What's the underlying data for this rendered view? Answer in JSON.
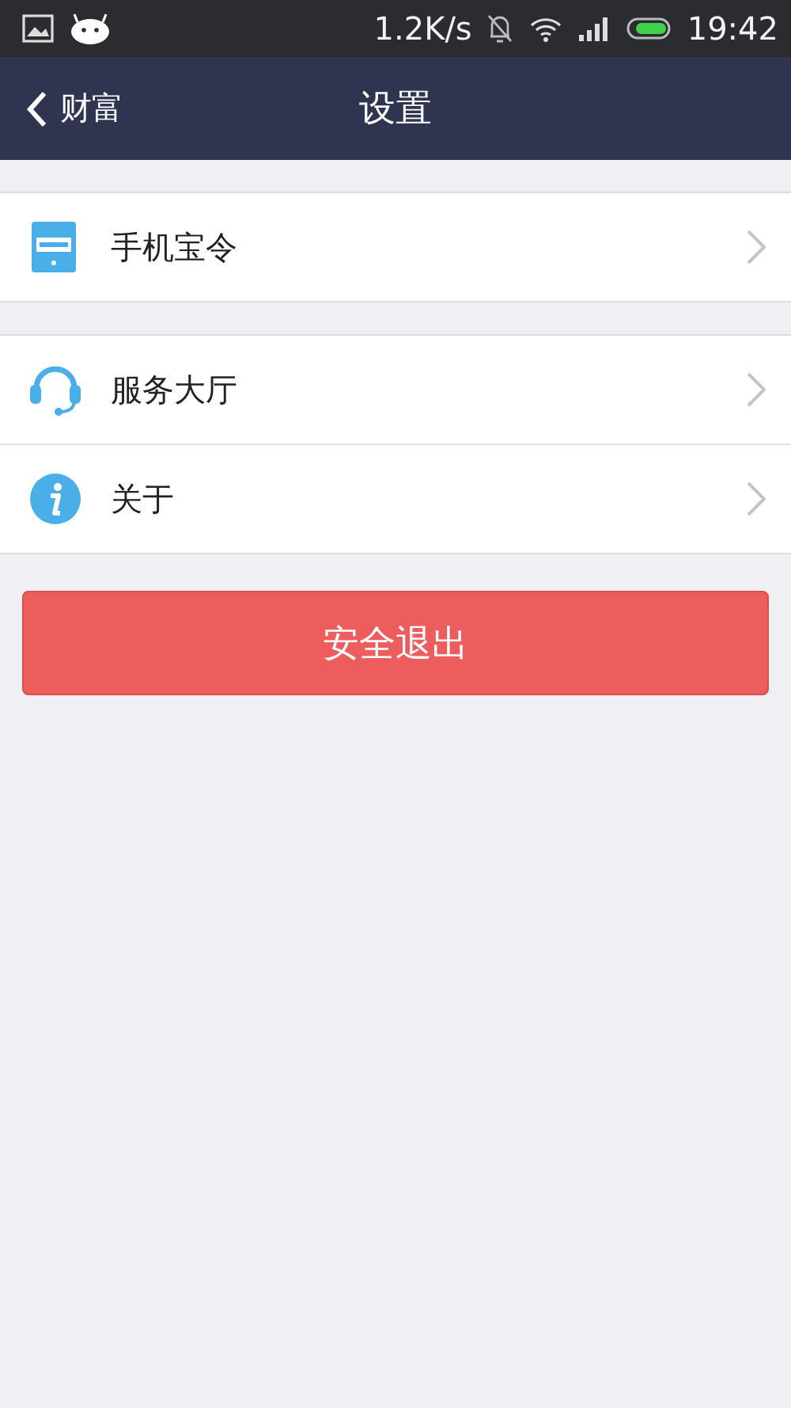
{
  "status_bar": {
    "speed": "1.2K/s",
    "time": "19:42"
  },
  "nav": {
    "back": "财富",
    "title": "设置"
  },
  "groups": [
    [
      {
        "kind": "token",
        "label": "手机宝令"
      }
    ],
    [
      {
        "kind": "headset",
        "label": "服务大厅"
      },
      {
        "kind": "info",
        "label": "关于"
      }
    ]
  ],
  "logout_button": "安全退出"
}
